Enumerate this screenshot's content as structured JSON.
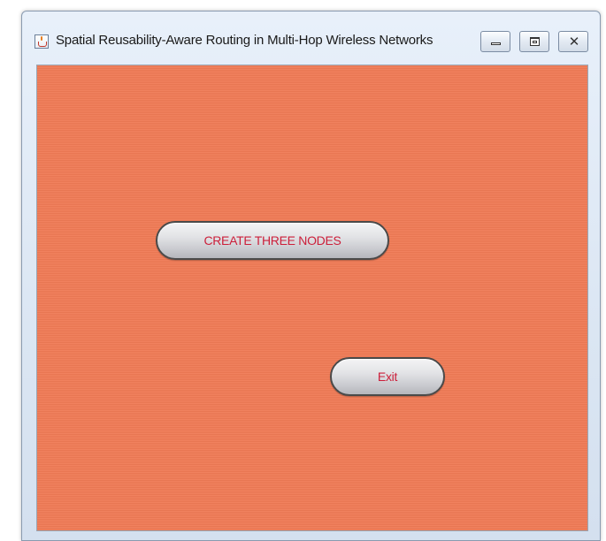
{
  "window": {
    "title": "Spatial Reusability-Aware Routing in Multi-Hop Wireless Networks",
    "icon": "java-icon",
    "controls": {
      "minimize_icon": "minimize-icon",
      "maximize_icon": "maximize-icon",
      "close_glyph": "✕",
      "close_icon": "close-icon"
    }
  },
  "main": {
    "background_color": "#f07a55",
    "buttons": {
      "create_three_nodes_label": "CREATE THREE NODES",
      "exit_label": "Exit"
    },
    "button_text_color": "#cc1f3a"
  }
}
